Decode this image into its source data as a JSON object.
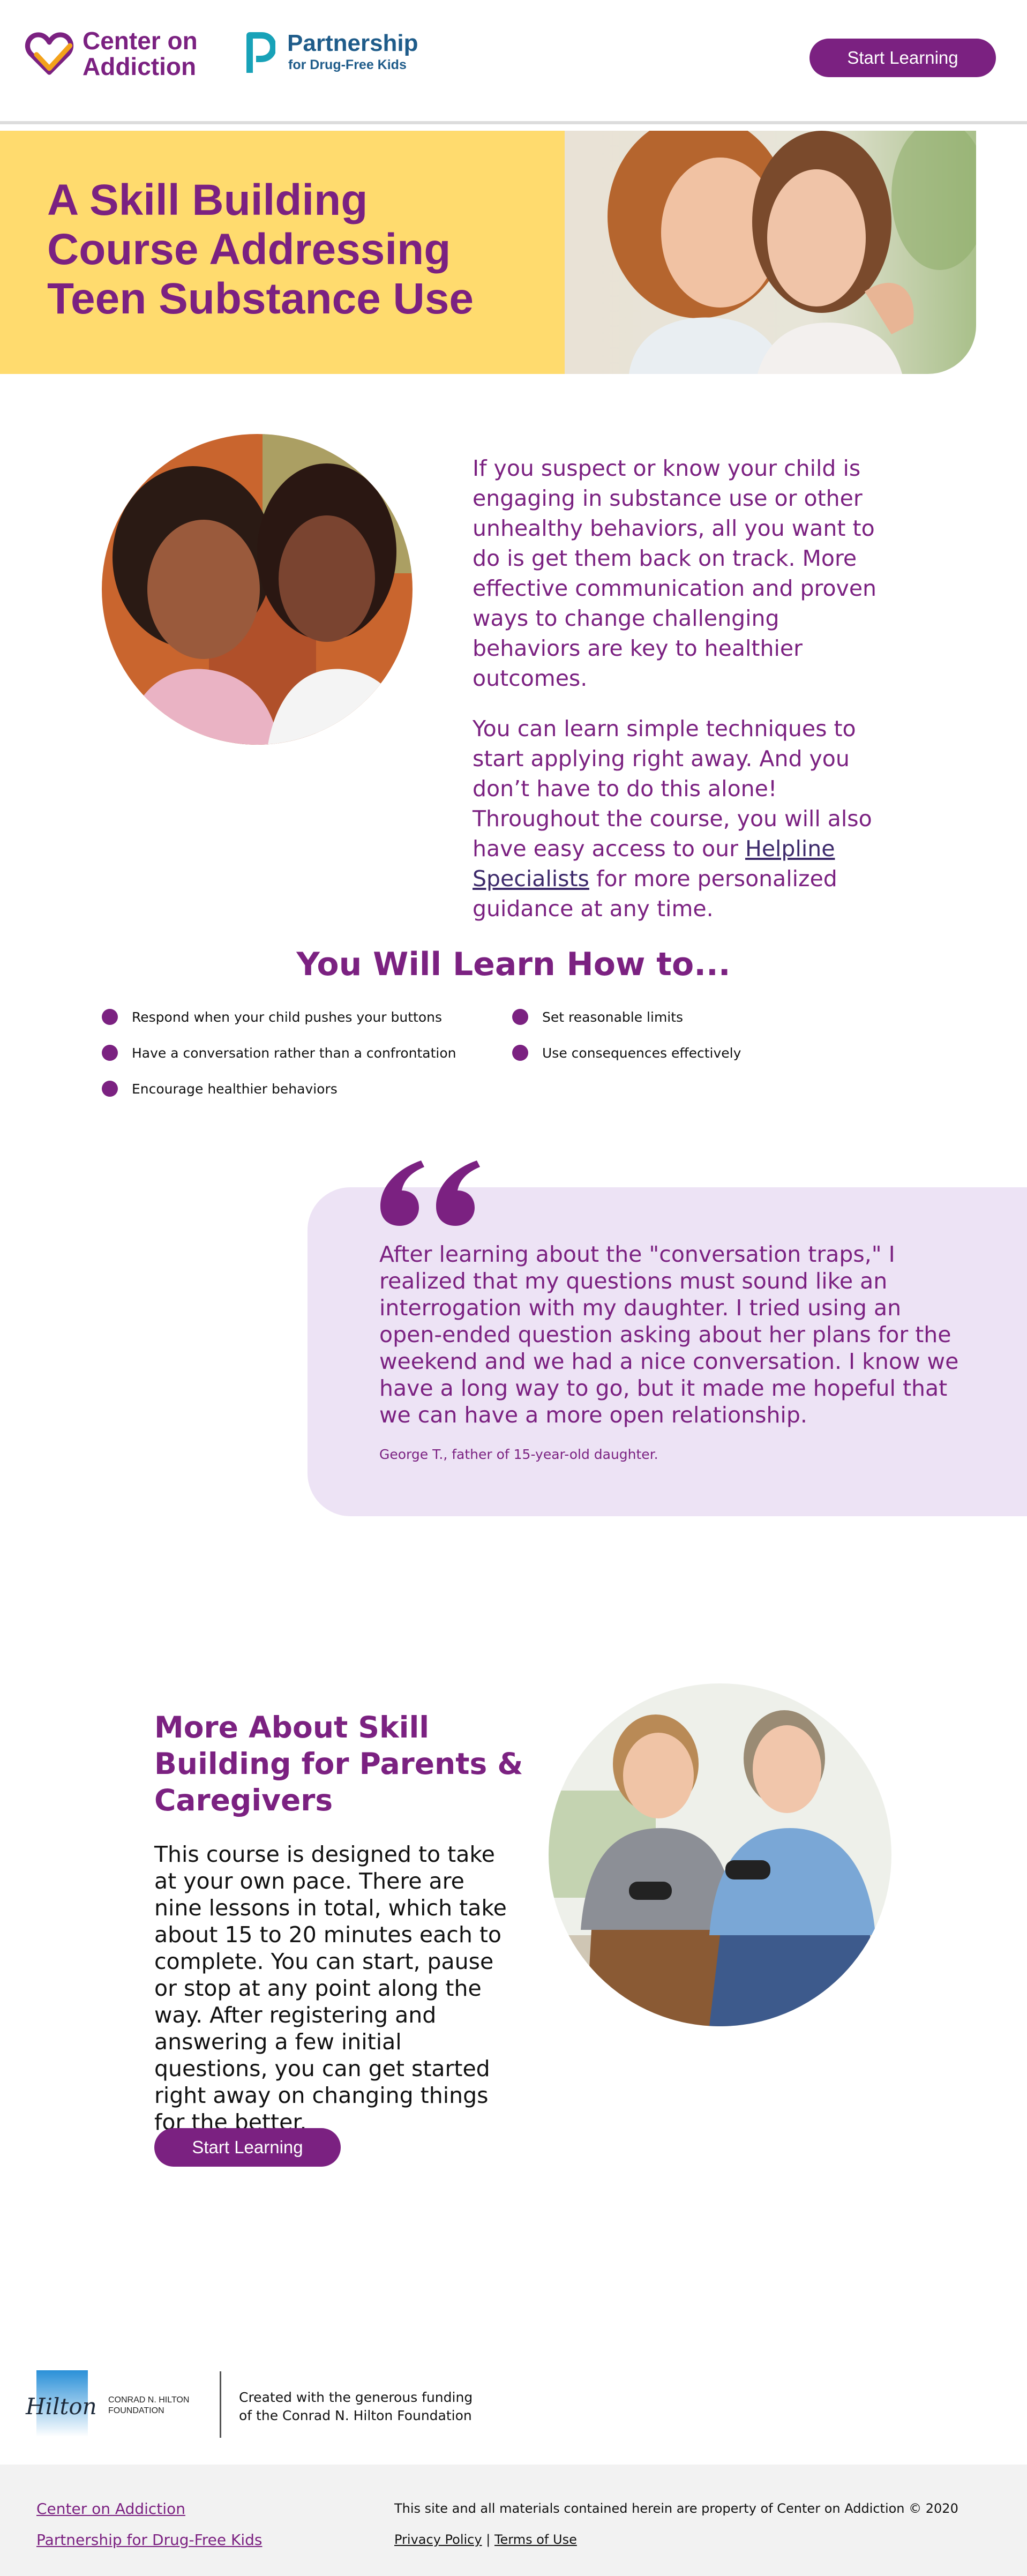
{
  "header": {
    "logo_coa": {
      "line1": "Center on",
      "line2": "Addiction"
    },
    "logo_pdfk": {
      "line1": "Partnership",
      "line2": "for Drug-Free Kids"
    },
    "cta_label": "Start Learning"
  },
  "hero": {
    "title": "A Skill Building Course Addressing Teen Substance Use",
    "photo": "mother-daughter-hug-photo"
  },
  "intro": {
    "photo": "two-women-smiling-photo",
    "paragraph1": "If you suspect or know your child is engaging in substance use or other unhealthy behaviors, all you want to do is get them back on track. More effective communication and proven ways to change challenging behaviors are key to healthier outcomes.",
    "paragraph2_before": "You can learn simple techniques to start applying right away. And you don’t have to do this alone! Throughout the course, you will also have easy access to our ",
    "paragraph2_link": "Helpline Specialists",
    "paragraph2_after": " for more personalized guidance at any time."
  },
  "learn": {
    "title": "You Will Learn How to...",
    "items": [
      "Respond when your child pushes your buttons",
      "Have a conversation rather than a confrontation",
      "Encourage healthier behaviors",
      "Set reasonable limits",
      "Use consequences effectively"
    ]
  },
  "testimonial": {
    "quote": "After learning about the \"conversation traps,\" I realized that my questions must sound like an interrogation with my daughter. I tried using an open-ended question asking about her plans for the weekend and we had a nice conversation. I know we have a long way to go, but it made me hopeful that we can have a more open relationship.",
    "attribution": "George T., father of 15-year-old daughter."
  },
  "more": {
    "title": "More About Skill Building for Parents & Caregivers",
    "body": "This course is designed to take at your own pace. There are nine lessons in total, which take about 15 to 20 minutes each to complete. You can start, pause or stop at any point along the way. After registering and answering a few initial questions, you can get started right away on changing things for the better.",
    "cta_label": "Start Learning",
    "photo": "father-son-gaming-photo"
  },
  "funding": {
    "logo_script": "Hilton",
    "logo_line1": "CONRAD N. HILTON",
    "logo_line2": "FOUNDATION",
    "text_line1": "Created with the generous funding",
    "text_line2": "of the Conrad N. Hilton Foundation"
  },
  "footer": {
    "link1": "Center on Addiction",
    "link2": "Partnership for Drug-Free Kids",
    "copyright": "This site and all materials contained herein are property of Center on Addiction © 2020",
    "privacy": "Privacy Policy",
    "separator": "|",
    "terms": "Terms of Use"
  },
  "colors": {
    "brand_purple": "#7b2181",
    "hero_yellow": "#ffdb6e",
    "quote_bg": "#ede3f5",
    "pdfk_blue": "#1f5c8a",
    "pdfk_teal": "#18a2b8",
    "heart_orange": "#f3a21b"
  }
}
